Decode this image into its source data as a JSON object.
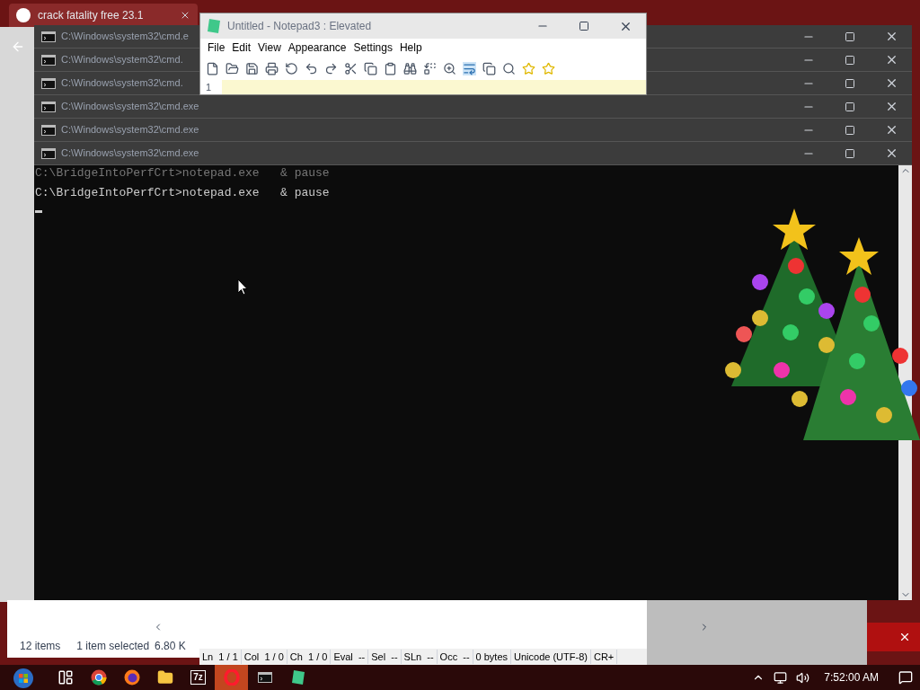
{
  "browser": {
    "tab_title": "crack fatality free 23.1"
  },
  "cmd_windows": [
    {
      "title": "C:\\Windows\\system32\\cmd.e"
    },
    {
      "title": "C:\\Windows\\system32\\cmd."
    },
    {
      "title": "C:\\Windows\\system32\\cmd."
    },
    {
      "title": "C:\\Windows\\system32\\cmd.exe"
    },
    {
      "title": "C:\\Windows\\system32\\cmd.exe"
    },
    {
      "title": "C:\\Windows\\system32\\cmd.exe"
    }
  ],
  "notepad": {
    "title": "Untitled - Notepad3 : Elevated",
    "menu": [
      "File",
      "Edit",
      "View",
      "Appearance",
      "Settings",
      "Help"
    ],
    "line_number": "1",
    "status": [
      "Ln  1 / 1",
      "Col  1 / 0",
      "Ch  1 / 0",
      "Eval  --",
      "Sel  --",
      "SLn  --",
      "Occ  --",
      "0 bytes",
      "Unicode (UTF-8)",
      "CR+"
    ]
  },
  "console": {
    "lines": [
      {
        "kind": "ghost",
        "text": "C:\\BridgeIntoPerfCrt>notepad.exe   & pause"
      },
      {
        "kind": "normal",
        "text": "C:\\BridgeIntoPerfCrt>notepad.exe   & pause"
      }
    ]
  },
  "explorer": {
    "item_count": "12 items",
    "selection": "1 item selected",
    "size": "6.80 K"
  },
  "taskbar": {
    "apps": [
      {
        "kind": "taskview",
        "selected": false
      },
      {
        "kind": "chrome",
        "selected": false
      },
      {
        "kind": "firefox",
        "selected": false
      },
      {
        "kind": "folder",
        "selected": false
      },
      {
        "kind": "sevenzip",
        "label": "7z",
        "selected": false
      },
      {
        "kind": "opera",
        "selected": true
      },
      {
        "kind": "cmd",
        "selected": false
      },
      {
        "kind": "notepad",
        "selected": false
      }
    ],
    "clock": "7:52:00 AM"
  }
}
